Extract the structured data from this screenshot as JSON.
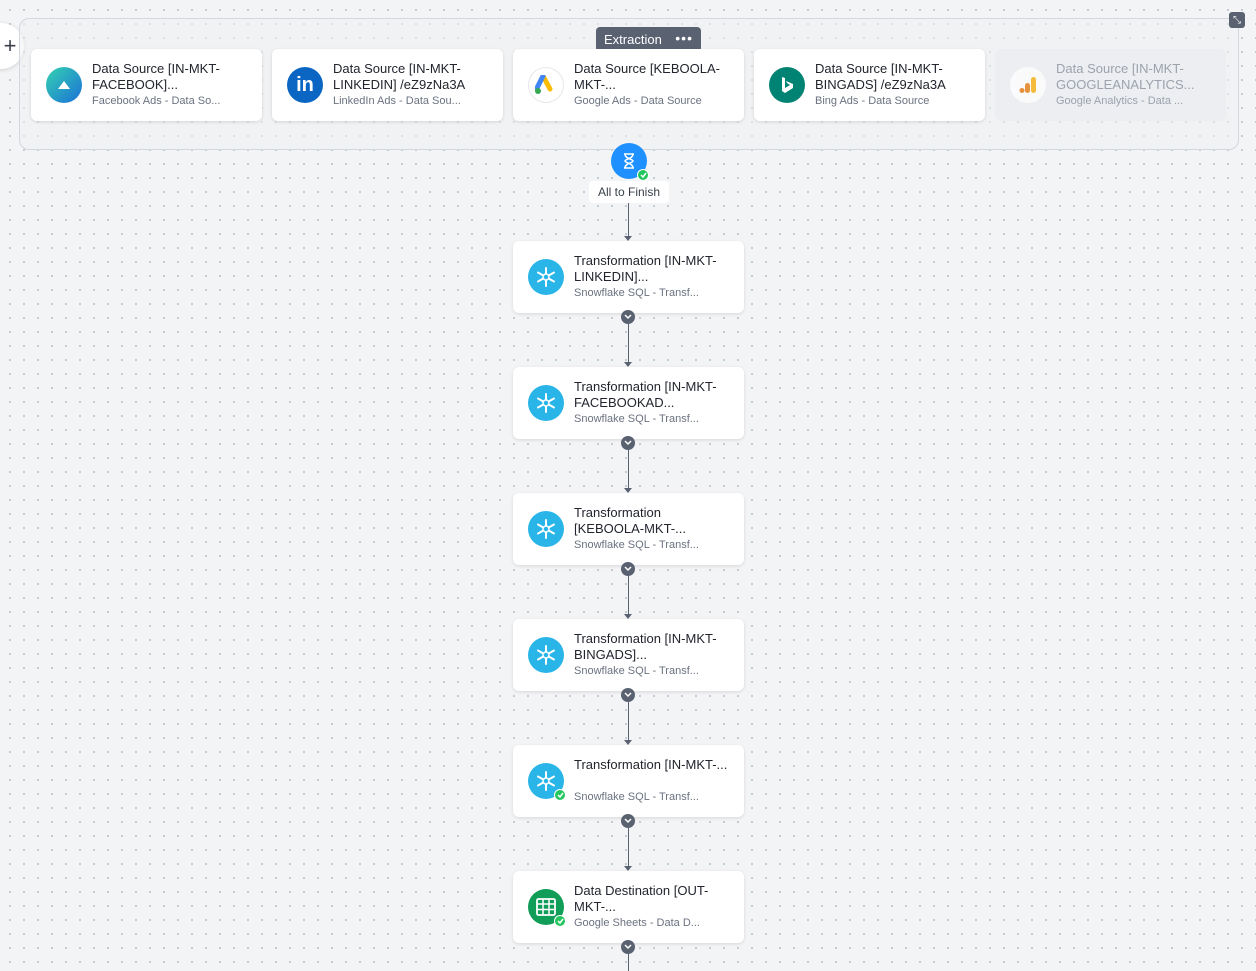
{
  "canvas": {
    "add_label": "+",
    "collapse_label": "⤡"
  },
  "phase": {
    "title": "Extraction",
    "menu_label": "•••",
    "tasks": [
      {
        "title": "Data Source [IN-MKT-FACEBOOK]...",
        "subtitle": "Facebook Ads - Data So...",
        "icon": "facebook-ads-icon",
        "enabled": true
      },
      {
        "title": "Data Source [IN-MKT-LINKEDIN] /eZ9zNa3A",
        "subtitle": "LinkedIn Ads - Data Sou...",
        "icon": "linkedin-icon",
        "enabled": true
      },
      {
        "title": "Data Source [KEBOOLA-MKT-...",
        "subtitle": "Google Ads - Data Source",
        "icon": "google-ads-icon",
        "enabled": true
      },
      {
        "title": "Data Source [IN-MKT-BINGADS] /eZ9zNa3A",
        "subtitle": "Bing Ads - Data Source",
        "icon": "bing-icon",
        "enabled": true
      },
      {
        "title": "Data Source [IN-MKT-GOOGLEANALYTICS...",
        "subtitle": "Google Analytics - Data ...",
        "icon": "google-analytics-icon",
        "enabled": false
      }
    ]
  },
  "wait": {
    "label": "All to Finish",
    "icon": "hourglass-icon",
    "status": "success"
  },
  "steps": [
    {
      "title": "Transformation [IN-MKT-LINKEDIN]...",
      "subtitle": "Snowflake SQL - Transf...",
      "icon": "snowflake-icon",
      "status": ""
    },
    {
      "title": "Transformation [IN-MKT-FACEBOOKAD...",
      "subtitle": "Snowflake SQL - Transf...",
      "icon": "snowflake-icon",
      "status": ""
    },
    {
      "title": "Transformation [KEBOOLA-MKT-...",
      "subtitle": "Snowflake SQL - Transf...",
      "icon": "snowflake-icon",
      "status": ""
    },
    {
      "title": "Transformation [IN-MKT-BINGADS]...",
      "subtitle": "Snowflake SQL - Transf...",
      "icon": "snowflake-icon",
      "status": ""
    },
    {
      "title": "Transformation [IN-MKT-...",
      "subtitle": "Snowflake SQL - Transf...",
      "icon": "snowflake-icon",
      "status": "success"
    },
    {
      "title": "Data Destination [OUT-MKT-...",
      "subtitle": "Google Sheets - Data D...",
      "icon": "google-sheets-icon",
      "status": "success"
    }
  ],
  "colors": {
    "connector": "#5a6272",
    "success": "#22c55e",
    "snowflake": "#29b5e8",
    "sheets": "#0f9d58",
    "bing": "#008373",
    "linkedin": "#0a66c2",
    "wait": "#1e90ff"
  }
}
